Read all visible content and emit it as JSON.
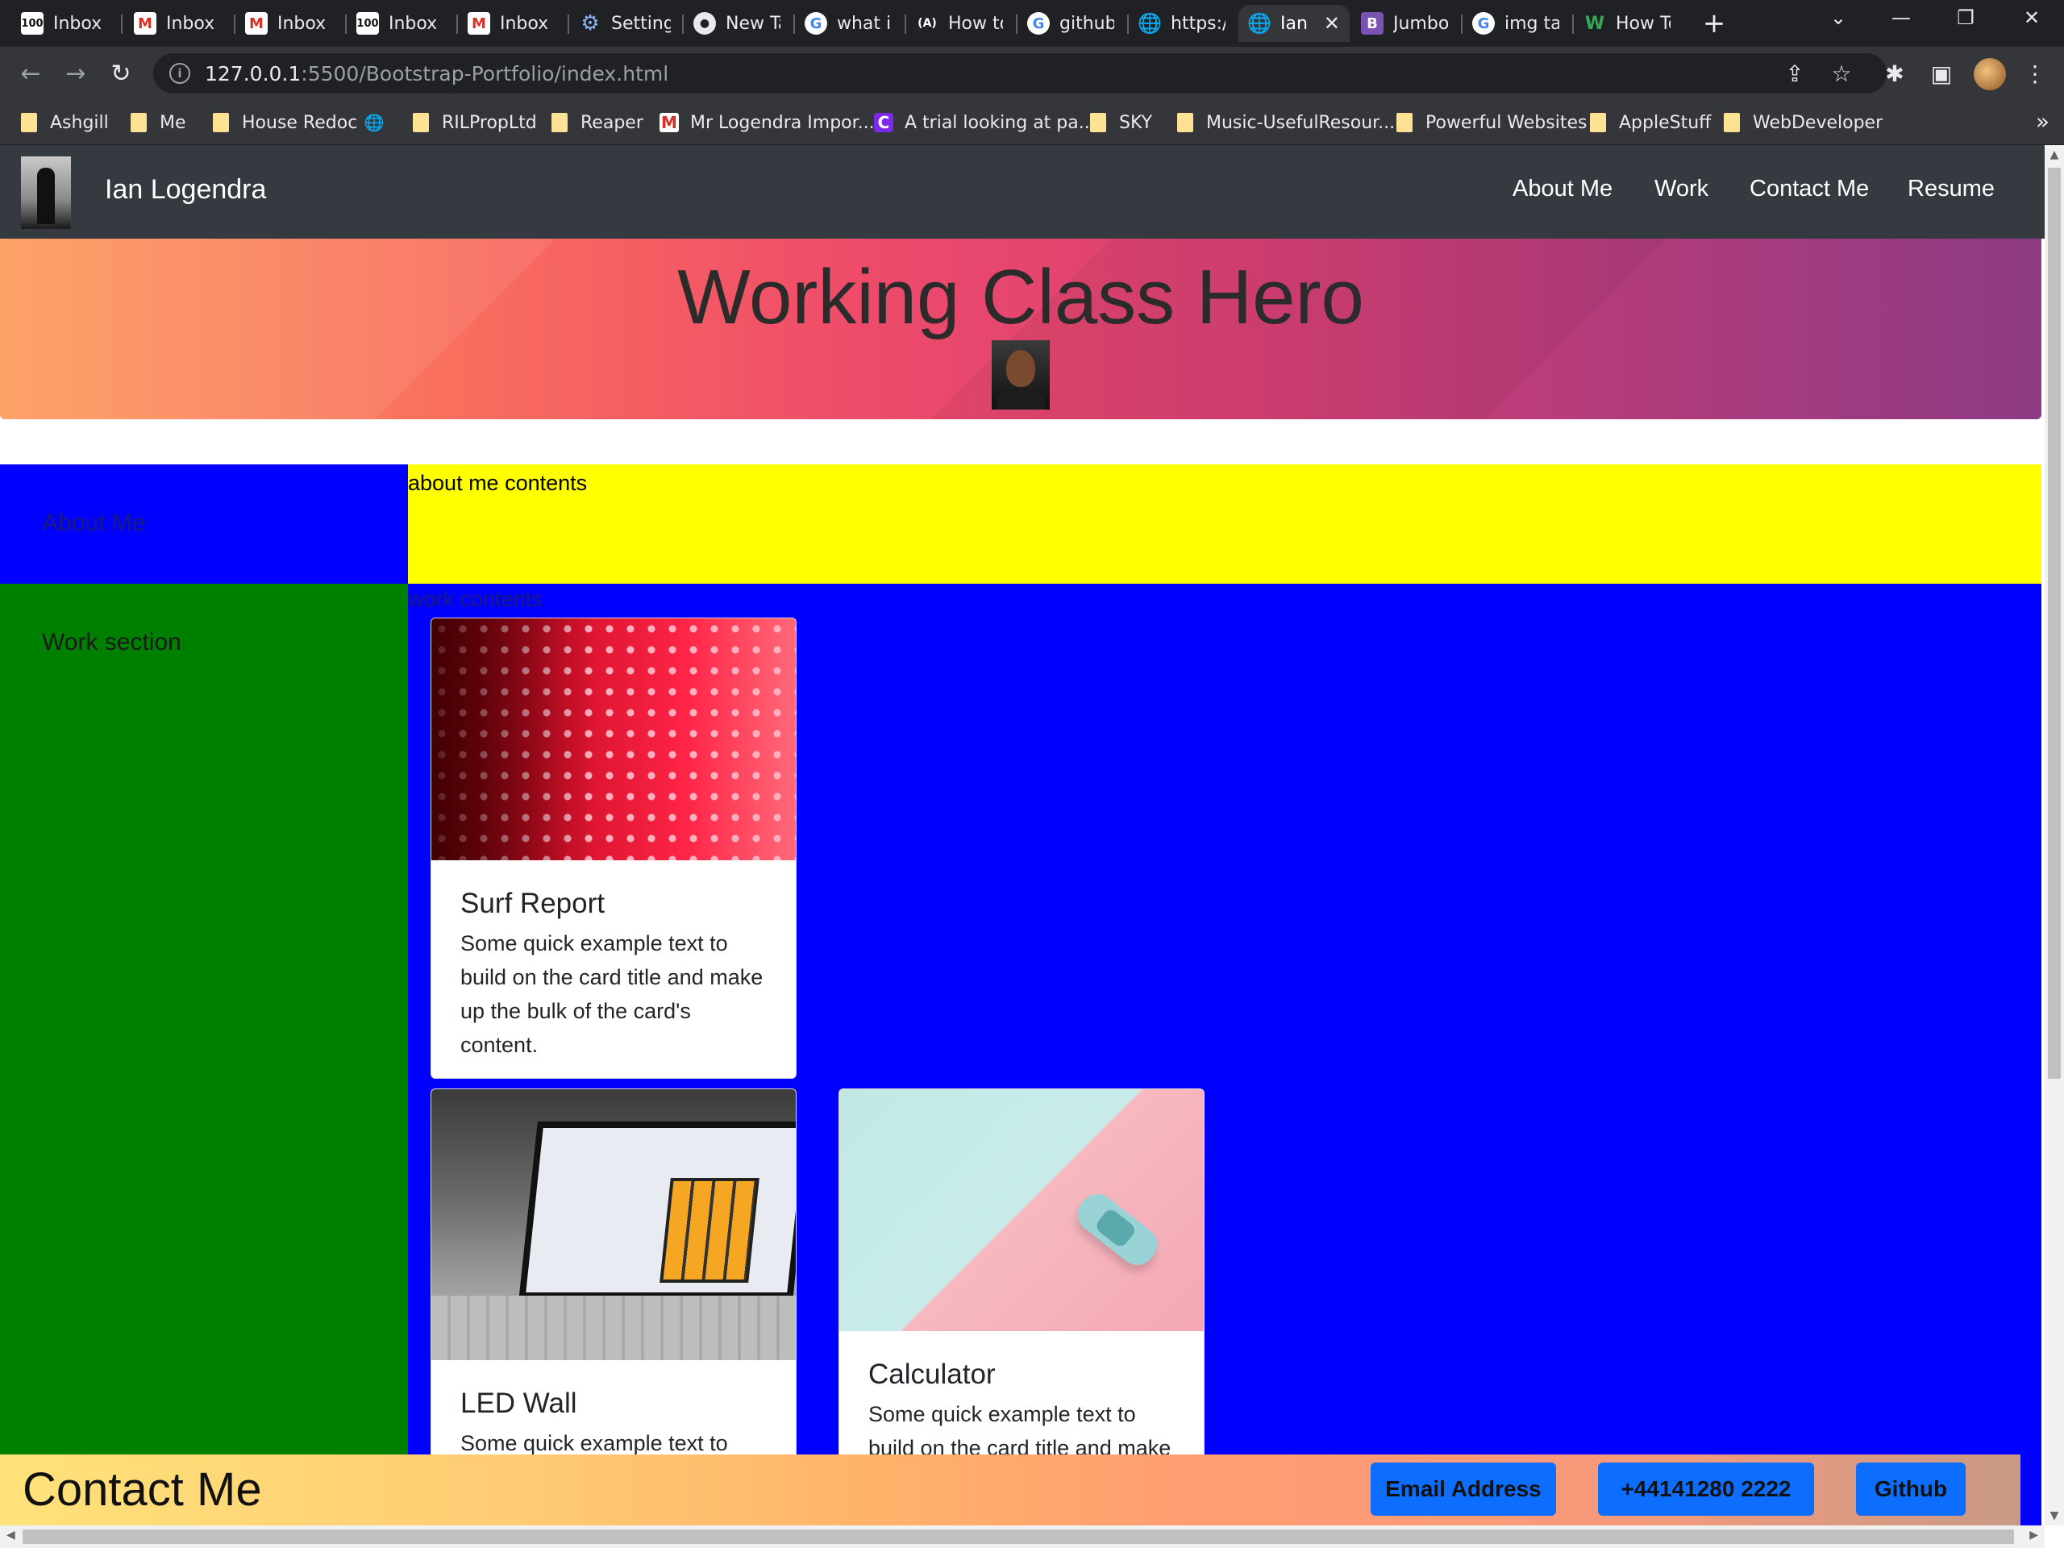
{
  "browser": {
    "tabs": [
      {
        "label": "Inbox (",
        "icon": "hundred-icon"
      },
      {
        "label": "Inbox (",
        "icon": "gmail-icon"
      },
      {
        "label": "Inbox (",
        "icon": "gmail-icon"
      },
      {
        "label": "Inbox (",
        "icon": "hundred-icon"
      },
      {
        "label": "Inbox (",
        "icon": "gmail-icon"
      },
      {
        "label": "Setting",
        "icon": "gear-icon"
      },
      {
        "label": "New Ta",
        "icon": "chrome-icon"
      },
      {
        "label": "what is",
        "icon": "google-icon"
      },
      {
        "label": "How to",
        "icon": "angular-icon"
      },
      {
        "label": "github",
        "icon": "google-icon"
      },
      {
        "label": "https://",
        "icon": "globe-icon"
      },
      {
        "label": "Ian",
        "icon": "globe-icon",
        "active": true
      },
      {
        "label": "Jumbot",
        "icon": "bootstrap-icon"
      },
      {
        "label": "img tag",
        "icon": "google-icon"
      },
      {
        "label": "How To",
        "icon": "w-icon"
      }
    ],
    "url_host": "127.0.0.1",
    "url_path": ":5500/Bootstrap-Portfolio/index.html",
    "bookmarks": [
      {
        "label": "Ashgill",
        "icon": "folder-icon"
      },
      {
        "label": "Me",
        "icon": "folder-icon"
      },
      {
        "label": "House Redoc",
        "icon": "folder-icon"
      },
      {
        "label": "",
        "icon": "globe-icon"
      },
      {
        "label": "RILPropLtd",
        "icon": "folder-icon"
      },
      {
        "label": "Reaper",
        "icon": "folder-icon"
      },
      {
        "label": "Mr Logendra Impor...",
        "icon": "gmail-icon"
      },
      {
        "label": "A trial looking at pa...",
        "icon": "canva-icon"
      },
      {
        "label": "SKY",
        "icon": "folder-icon"
      },
      {
        "label": "Music-UsefulResour...",
        "icon": "folder-icon"
      },
      {
        "label": "Powerful Websites",
        "icon": "folder-icon"
      },
      {
        "label": "AppleStuff",
        "icon": "folder-icon"
      },
      {
        "label": "WebDeveloper",
        "icon": "folder-icon"
      }
    ]
  },
  "site": {
    "brand": "Ian Logendra",
    "nav": [
      "About Me",
      "Work",
      "Contact Me",
      "Resume"
    ],
    "hero_title": "Working Class Hero",
    "about_heading": "About Me",
    "about_text": "about me contents",
    "work_heading": "Work section",
    "work_text": "work contents",
    "cards": [
      {
        "title": "Surf Report",
        "text": "Some quick example text to build on the card title and make up the bulk of the card's content."
      },
      {
        "title": "LED Wall",
        "text": "Some quick example text to build on the card title and make up the bulk of the card's content."
      },
      {
        "title": "Calculator",
        "text": "Some quick example text to build on the card title and make up the bulk of the card's content."
      }
    ],
    "footer": {
      "title": "Contact Me",
      "buttons": [
        "Email Address",
        "+44141280 2222",
        "Github"
      ]
    }
  },
  "colors": {
    "navbar": "#343a40",
    "about_side": "#0000ff",
    "about_content": "#ffff00",
    "work_side": "#008000",
    "work_content": "#0000ff",
    "button": "#0d6efd"
  }
}
